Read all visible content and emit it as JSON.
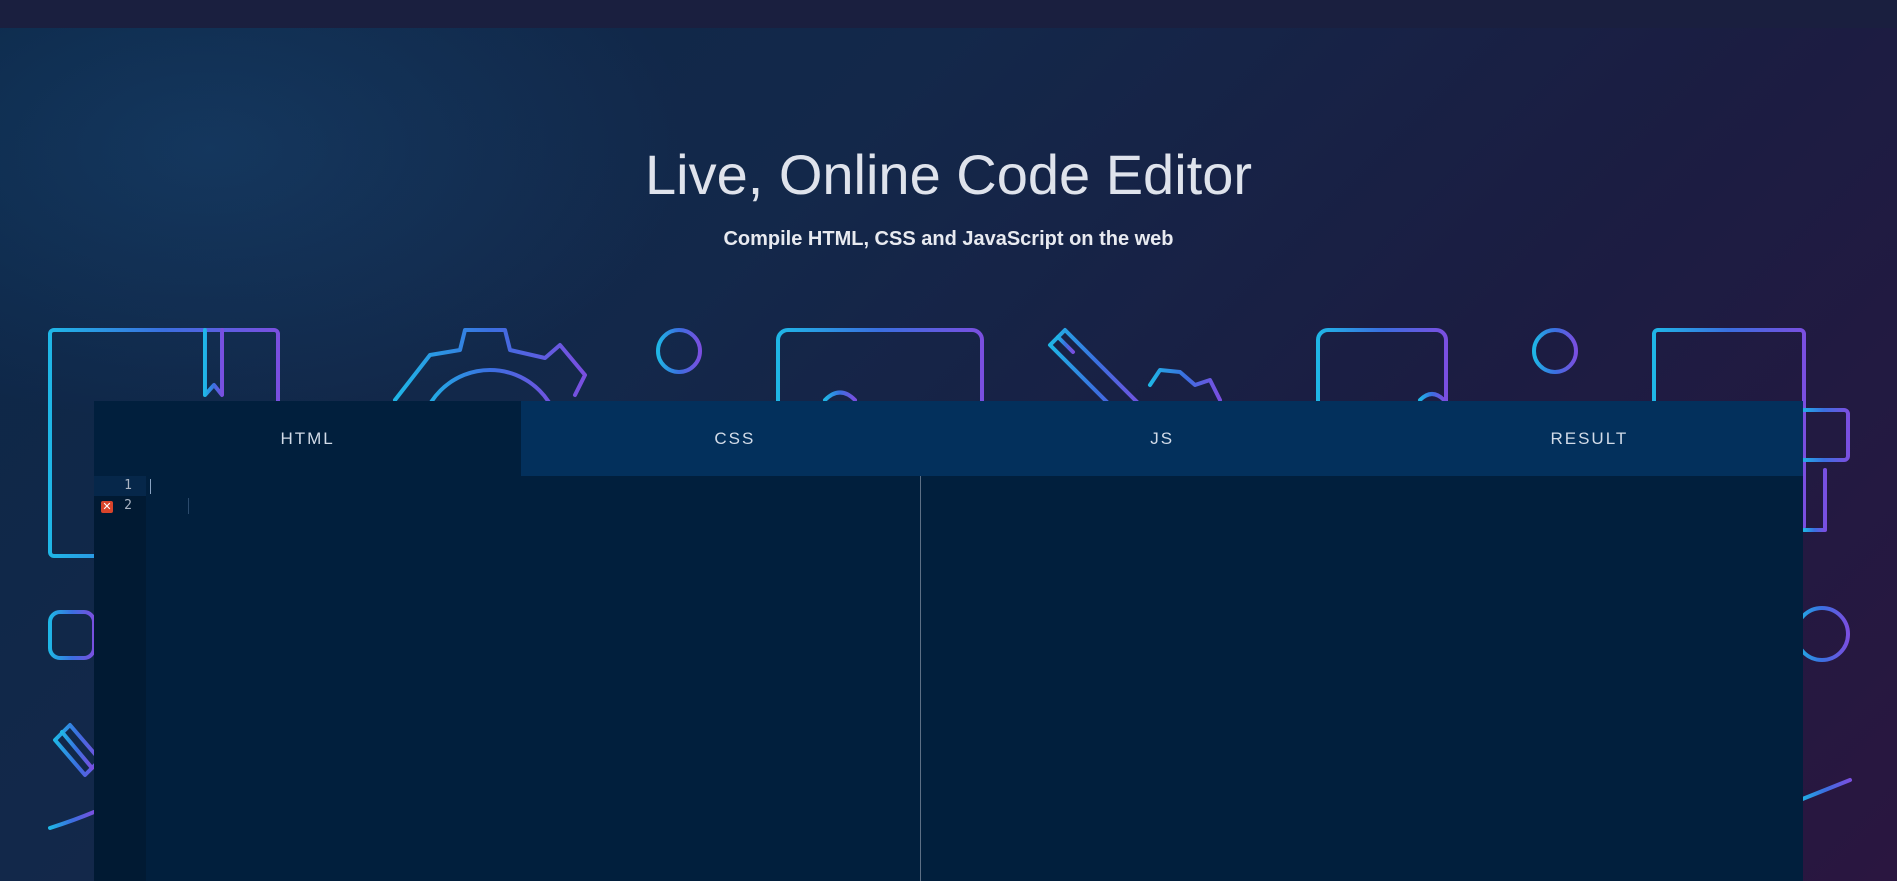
{
  "hero": {
    "title": "Live, Online Code Editor",
    "subtitle": "Compile HTML, CSS and JavaScript on the web"
  },
  "tabs": [
    {
      "label": "HTML",
      "active": true
    },
    {
      "label": "CSS",
      "active": false
    },
    {
      "label": "JS",
      "active": false
    },
    {
      "label": "RESULT",
      "active": false
    }
  ],
  "editor": {
    "line_numbers": [
      "1",
      "2"
    ],
    "error_marker_line": "2",
    "error_icon": "error-x-icon"
  },
  "colors": {
    "background_start": "#0c2747",
    "background_end": "#2a1640",
    "tab_bar": "#03305c",
    "editor_bg": "#011f3d",
    "decor_cyan": "#1fb6e6",
    "decor_blue": "#3b6fe0",
    "decor_purple": "#7a4fe0"
  },
  "decorative_icons": [
    "book-icon",
    "gear-icon",
    "monitor-icon",
    "pencil-icon",
    "tablet-icon",
    "document-icon",
    "circle-icon"
  ]
}
